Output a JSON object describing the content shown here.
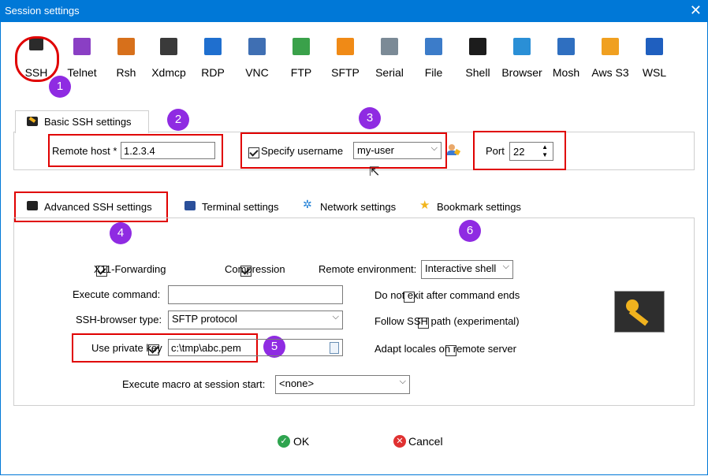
{
  "window": {
    "title": "Session settings"
  },
  "protocols": [
    {
      "label": "SSH",
      "icon": "ssh-key-icon",
      "color": "#2b2b2b"
    },
    {
      "label": "Telnet",
      "icon": "telnet-icon",
      "color": "#8a3fc4"
    },
    {
      "label": "Rsh",
      "icon": "rsh-icon",
      "color": "#d7701b"
    },
    {
      "label": "Xdmcp",
      "icon": "xdmcp-icon",
      "color": "#3a3a3a"
    },
    {
      "label": "RDP",
      "icon": "rdp-icon",
      "color": "#1f6fcf"
    },
    {
      "label": "VNC",
      "icon": "vnc-icon",
      "color": "#3f6fb3"
    },
    {
      "label": "FTP",
      "icon": "ftp-globe-icon",
      "color": "#3aa14a"
    },
    {
      "label": "SFTP",
      "icon": "sftp-globe-icon",
      "color": "#f08a16"
    },
    {
      "label": "Serial",
      "icon": "serial-plug-icon",
      "color": "#7b8a96"
    },
    {
      "label": "File",
      "icon": "file-monitor-icon",
      "color": "#3c7cc9"
    },
    {
      "label": "Shell",
      "icon": "shell-terminal-icon",
      "color": "#1c1c1c"
    },
    {
      "label": "Browser",
      "icon": "browser-globe-icon",
      "color": "#2a8fd6"
    },
    {
      "label": "Mosh",
      "icon": "mosh-satellite-icon",
      "color": "#2f6fc0"
    },
    {
      "label": "Aws S3",
      "icon": "aws-s3-cubes-icon",
      "color": "#f0a020"
    },
    {
      "label": "WSL",
      "icon": "wsl-windows-icon",
      "color": "#1f5fbf"
    }
  ],
  "badges": [
    "1",
    "2",
    "3",
    "4",
    "5",
    "6"
  ],
  "basic": {
    "tab_label": "Basic SSH settings",
    "remote_host_label": "Remote host *",
    "remote_host_value": "1.2.3.4",
    "specify_username_label": "Specify username",
    "specify_username_checked": true,
    "username_value": "my-user",
    "port_label": "Port",
    "port_value": "22"
  },
  "tabs": [
    {
      "label": "Advanced SSH settings",
      "icon": "key-icon"
    },
    {
      "label": "Terminal settings",
      "icon": "terminal-icon"
    },
    {
      "label": "Network settings",
      "icon": "network-icon"
    },
    {
      "label": "Bookmark settings",
      "icon": "star-icon"
    }
  ],
  "advanced": {
    "x11_label": "X11-Forwarding",
    "compression_label": "Compression",
    "remote_env_label": "Remote environment:",
    "remote_env_value": "Interactive shell",
    "exec_cmd_label": "Execute command:",
    "exec_cmd_value": "",
    "no_exit_label": "Do not exit after command ends",
    "browser_type_label": "SSH-browser type:",
    "browser_type_value": "SFTP protocol",
    "follow_path_label": "Follow SSH path (experimental)",
    "private_key_label": "Use private key",
    "private_key_value": "c:\\tmp\\abc.pem",
    "adapt_locales_label": "Adapt locales on remote server",
    "macro_label": "Execute macro at session start:",
    "macro_value": "<none>"
  },
  "footer": {
    "ok_label": "OK",
    "cancel_label": "Cancel"
  },
  "colors": {
    "accent": "#0078d7",
    "highlight": "#e00000",
    "badge": "#8f2be2"
  }
}
